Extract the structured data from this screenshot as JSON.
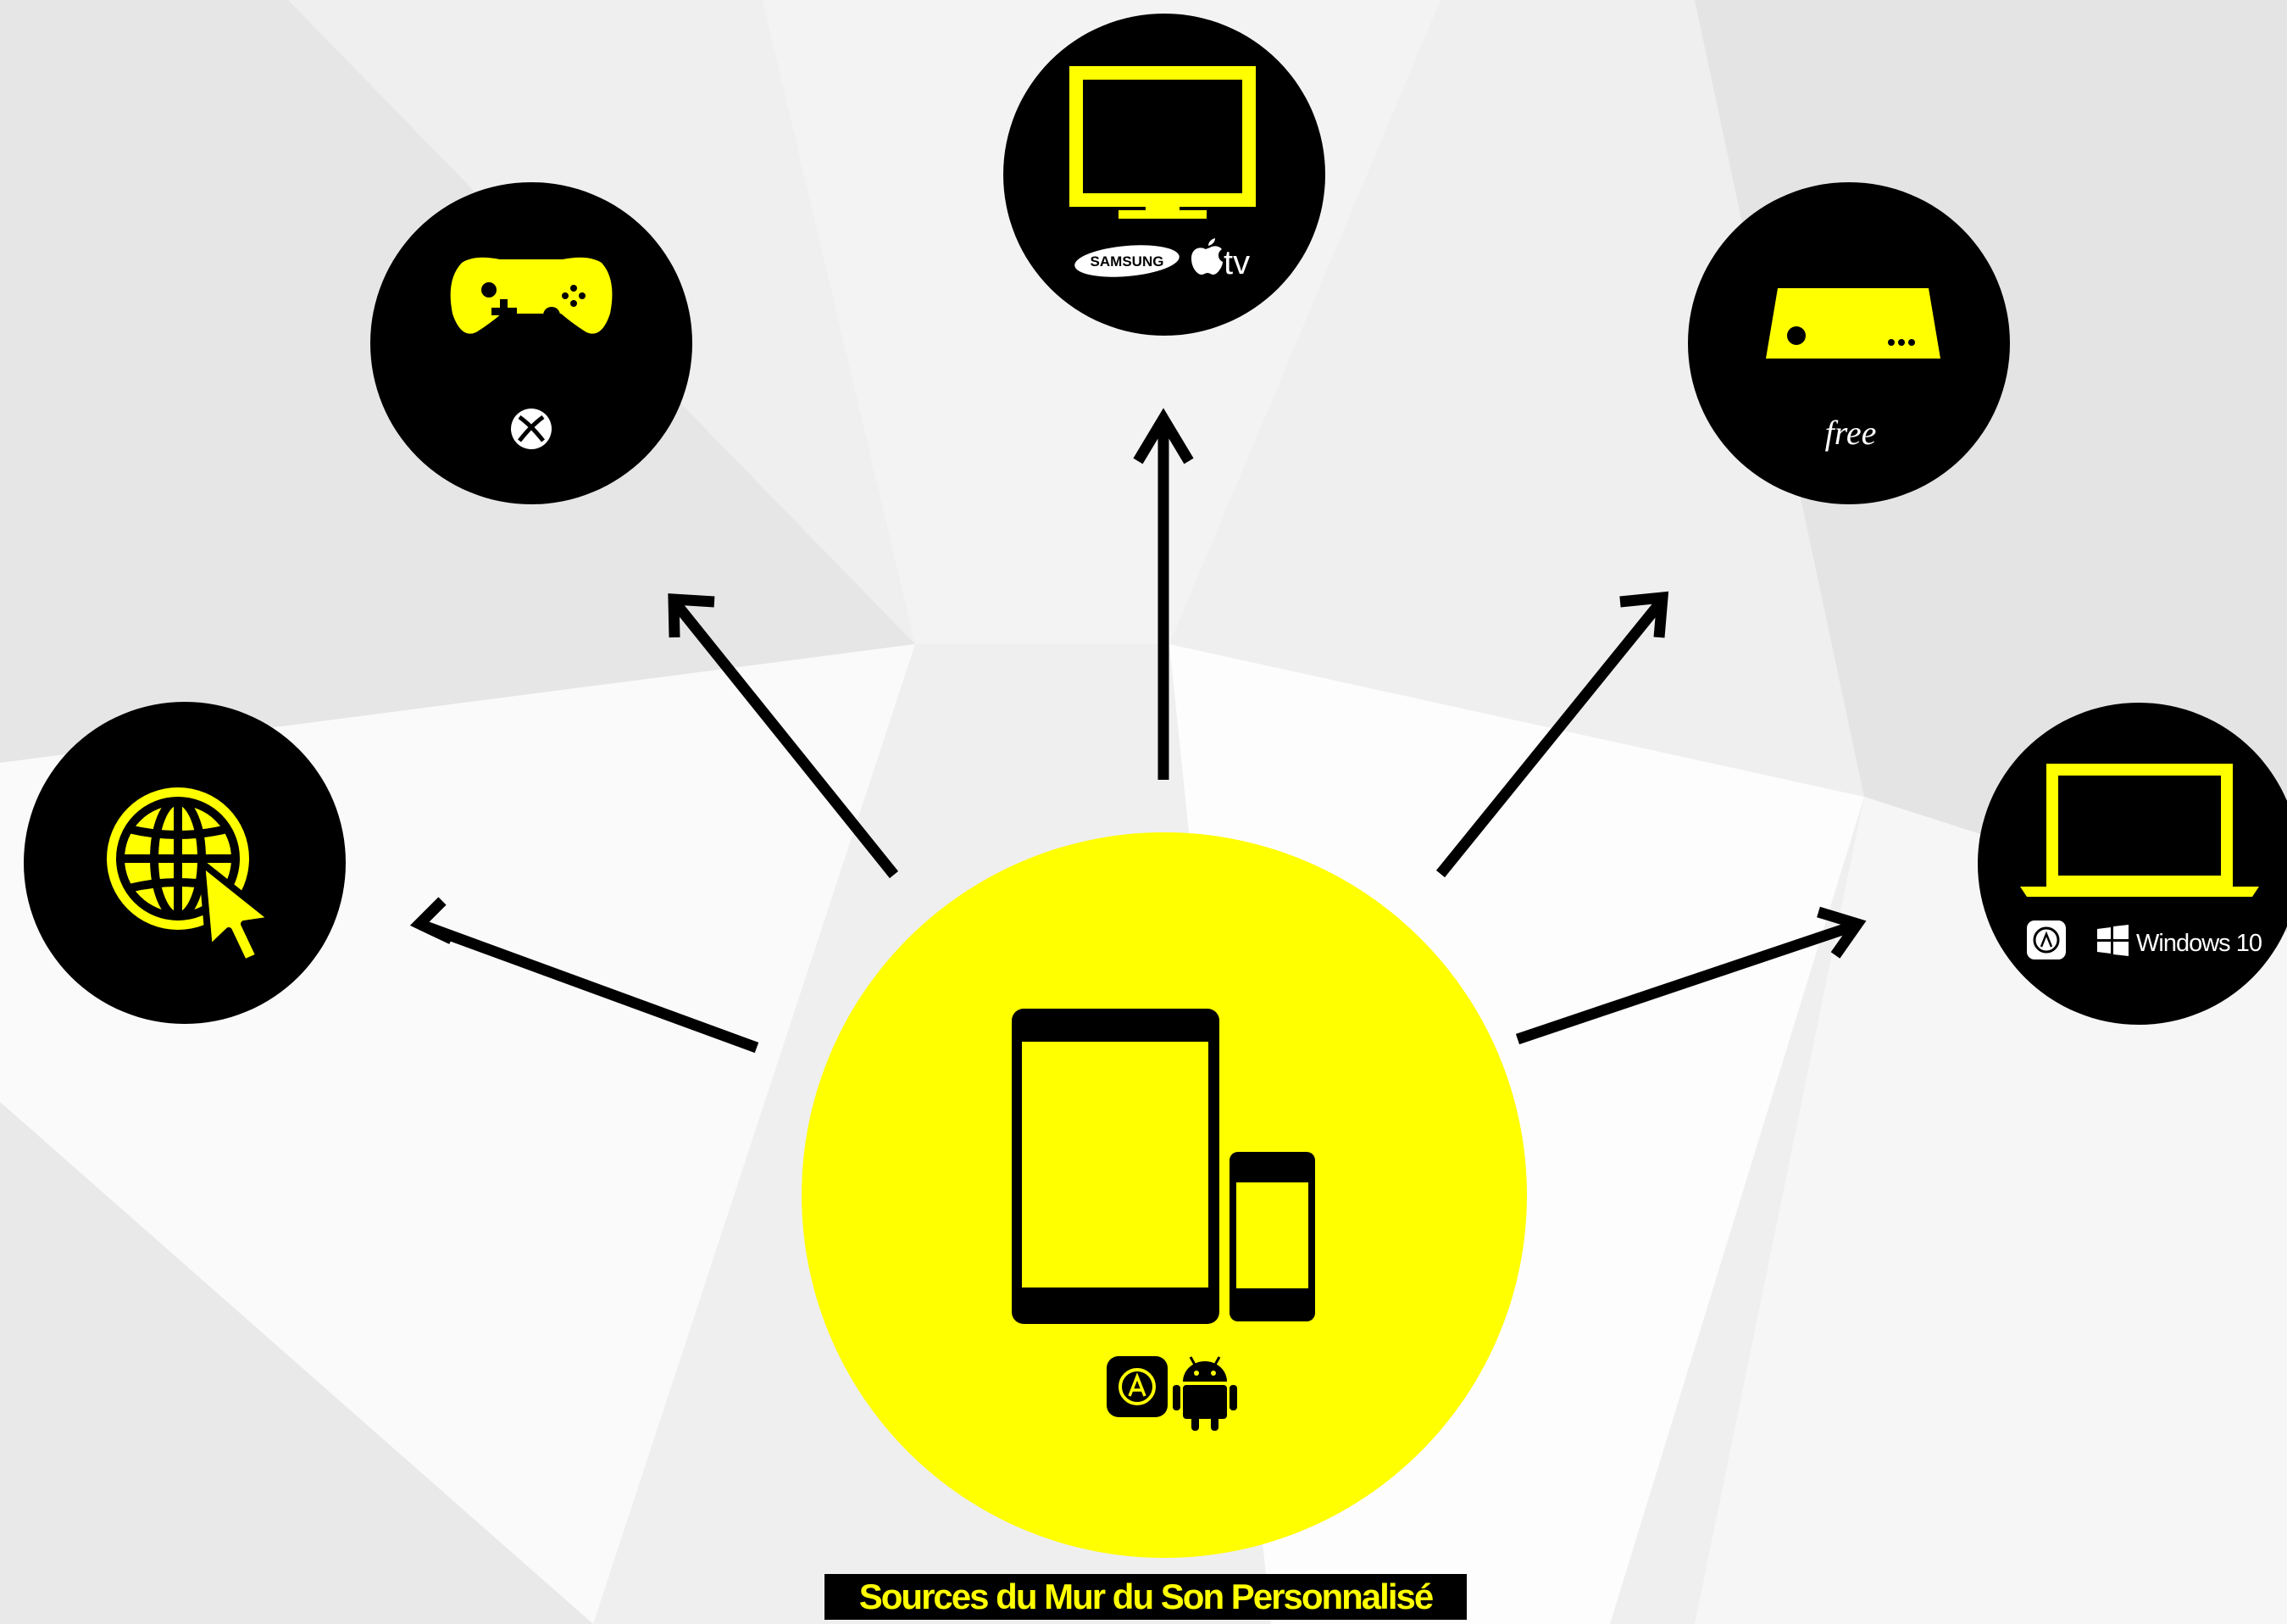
{
  "colors": {
    "accent": "#ffff00",
    "dark": "#000000",
    "background": "#efefef"
  },
  "center": {
    "name": "Mobile devices",
    "icons": [
      "tablet-icon",
      "phone-icon",
      "app-store-icon",
      "android-icon"
    ]
  },
  "targets": [
    {
      "id": "web",
      "icon": "globe-cursor-icon",
      "brands": []
    },
    {
      "id": "console",
      "icon": "gamepad-icon",
      "brands": [
        "xbox-logo"
      ]
    },
    {
      "id": "tv",
      "icon": "tv-monitor-icon",
      "brands": [
        "samsung-logo",
        "apple-tv-logo"
      ],
      "samsung_text": "SAMSUNG",
      "appletv_text": "tv"
    },
    {
      "id": "box",
      "icon": "set-top-box-icon",
      "brands": [
        "free-logo"
      ],
      "free_text": "free"
    },
    {
      "id": "computer",
      "icon": "laptop-icon",
      "brands": [
        "mac-app-store-logo",
        "windows-logo"
      ],
      "windows_text": "Windows 10"
    }
  ],
  "caption": "Sources du Mur du Son Personnalisé"
}
